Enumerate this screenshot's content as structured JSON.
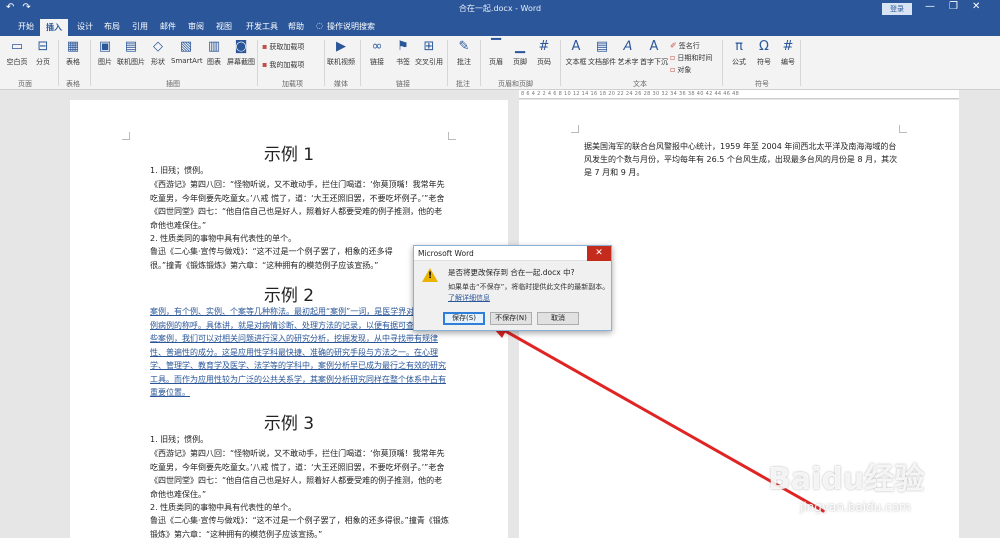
{
  "titlebar": {
    "title": "合在一起.docx - Word",
    "login": "登录",
    "undo": "↶",
    "redo": "↷",
    "minimize": "—",
    "restore": "❐",
    "close": "✕"
  },
  "tabs": [
    "开始",
    "插入",
    "设计",
    "布局",
    "引用",
    "邮件",
    "审阅",
    "视图",
    "开发工具",
    "帮助"
  ],
  "active_tab": "插入",
  "tell_me": "操作说明搜索",
  "ribbon": {
    "page_group": {
      "cover": "空白页",
      "break": "分页",
      "label": "页面"
    },
    "table_group": {
      "table": "表格",
      "label": "表格"
    },
    "illustrations": {
      "picture": "图片",
      "online_picture": "联机图片",
      "shapes": "形状",
      "smartart": "SmartArt",
      "chart": "图表",
      "screenshot": "屏幕截图",
      "label": "插图"
    },
    "addins": {
      "get": "获取加载项",
      "mine": "我的加载项",
      "label": "加载项"
    },
    "media": {
      "video": "联机视频",
      "label": "媒体"
    },
    "links": {
      "link": "链接",
      "bookmark": "书签",
      "xref": "交叉引用",
      "label": "链接"
    },
    "comments": {
      "comment": "批注",
      "label": "批注"
    },
    "header_footer": {
      "header": "页眉",
      "footer": "页脚",
      "page_number": "页码",
      "label": "页眉和页脚"
    },
    "text": {
      "textbox": "文本框",
      "quickparts": "文档部件",
      "wordart": "艺术字",
      "dropcap": "首字下沉",
      "signature": "签名行",
      "datetime": "日期和时间",
      "object": "对象",
      "label": "文本"
    },
    "symbols": {
      "equation": "公式",
      "symbol": "符号",
      "number": "编号",
      "label": "符号"
    }
  },
  "ruler_numbers": "8  6  4  2     2  4  6  8  10  12  14  16  18  20  22  24  26  28  30  32  34  36  38  40  42  44  46  48",
  "page1": {
    "heading1": "示例 1",
    "s1_item1": "1. 旧残；惯例。",
    "s1_p1": "《西游记》第四八回：“怪物听说，又不敢动手，拦住门喝道：‘你莫顶嘴！我常年先吃童男，今年倒要先吃童女。’八戒 慌了，道：‘大王还照旧罢，不要吃坏例子。’”老舍《四世同堂》四七：“他自信自己也是好人，照着好人都要受难的例子推测，他的老命他也难保住。”",
    "s1_item2": "2. 性质类同的事物中具有代表性的单个。",
    "s1_p2": "鲁迅《二心集·宣传与做戏》：“这不过是一个例子罢了，相象的还多得很。”撞青《锻炼锻炼》第六章：“这种拥有的模范例子应该宣扬。”",
    "heading2": "示例 2",
    "s2_p": "案例，有个例、实例、个案等几种称法。最初起用“案例”一词，是医学界对典型和特例病例的称呼。具体讲，就是对病情诊断、处理方法的记录，以便有据可查。通过这些案例，我们可以对相关问题进行深入的研究分析，挖掘发现，从中寻找带有规律性、普遍性的成分。这是应用性学科最快捷、准确的研究手段与方法之一。在心理学、管理学、教育学及医学、法学等的学科中，案例分析早已成为最行之有效的研究工具。而作为应用性较为广泛的公共关系学，其案例分析研究同样在整个体系中占有重要位置。",
    "heading3": "示例 3",
    "s3_item1": "1. 旧残；惯例。",
    "s3_p1": "《西游记》第四八回：“怪物听说，又不敢动手，拦住门喝道：‘你莫顶嘴！我常年先吃童男，今年倒要先吃童女。’八戒 慌了，道：‘大王还照旧罢，不要吃坏例子。’”老舍《四世同堂》四七：“他自信自己也是好人，照着好人都要受难的例子推测，他的老命他也难保住。”",
    "s3_item2": "2. 性质类同的事物中具有代表性的单个。",
    "s3_p2": "鲁迅《二心集·宣传与做戏》：“这不过是一个例子罢了，相象的还多得很。”撞青《锻炼锻炼》第六章：“这种拥有的模范例子应该宣扬。”"
  },
  "page2": {
    "text": "据美国海军的联合台风警报中心统计，1959 年至 2004 年间西北太平洋及南海海域的台风发生的个数与月份，平均每年有 26.5 个台风生成，出现最多台风的月份是 8 月，其次是 7 月和 9 月。"
  },
  "dialog": {
    "title": "Microsoft Word",
    "question": "是否将更改保存到 合在一起.docx 中?",
    "info": "如果单击“不保存”，将临时提供此文件的最新副本。",
    "link": "了解详细信息",
    "save": "保存(S)",
    "dont_save": "不保存(N)",
    "cancel": "取消",
    "close": "✕"
  },
  "watermark": {
    "brand": "Baidu经验",
    "url": "jingyan.baidu.com"
  },
  "colors": {
    "accent": "#2b579a",
    "arrow": "#e02424",
    "close": "#c42b1c"
  }
}
